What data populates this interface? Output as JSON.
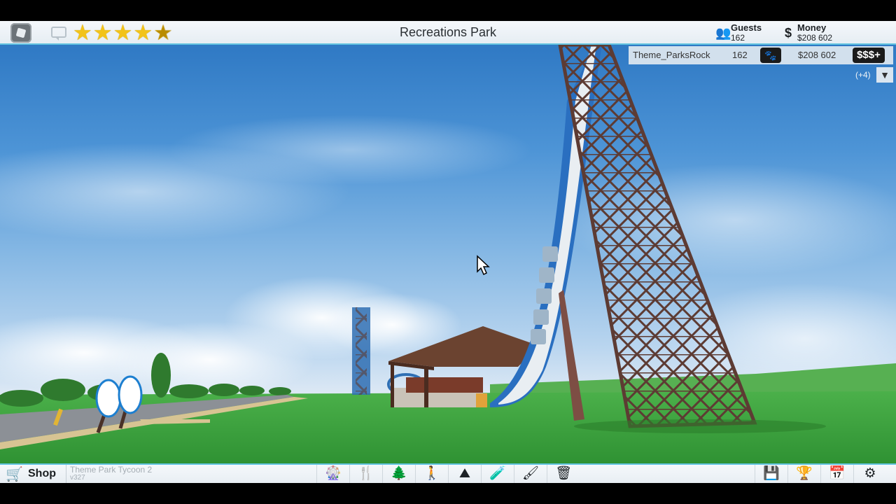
{
  "topbar": {
    "park_name": "Recreations Park",
    "rating_stars": 4.5,
    "guests": {
      "label": "Guests",
      "value": "162",
      "icon": "guests-icon"
    },
    "money": {
      "label": "Money",
      "value": "$208 602",
      "icon": "dollar-icon"
    }
  },
  "player_list": {
    "player_name": "Theme_ParksRock",
    "guests": "162",
    "money": "$208 602",
    "add_money_label": "$$$+",
    "more_players": "(+4)",
    "expand_glyph": "▼"
  },
  "bottombar": {
    "shop_label": "Shop",
    "game_name": "Theme Park Tycoon 2",
    "game_version": "v327",
    "build_tools": [
      {
        "name": "rides-tool",
        "glyph": "🎡"
      },
      {
        "name": "food-stalls-tool",
        "glyph": "🍴"
      },
      {
        "name": "scenery-tool",
        "glyph": "🌲"
      },
      {
        "name": "paths-tool",
        "glyph": "🚶"
      },
      {
        "name": "terrain-tool",
        "glyph": "⛰"
      },
      {
        "name": "eyedropper-tool",
        "glyph": "🧪"
      },
      {
        "name": "paint-tool",
        "glyph": "🖌"
      },
      {
        "name": "delete-tool",
        "glyph": "🗑"
      }
    ],
    "utility_tools": [
      {
        "name": "save-tool",
        "glyph": "💾"
      },
      {
        "name": "trophy-tool",
        "glyph": "🏆"
      },
      {
        "name": "calendar-tool",
        "glyph": "📅"
      },
      {
        "name": "settings-tool",
        "glyph": "⚙"
      }
    ]
  },
  "colors": {
    "accent": "#61c3e0",
    "star": "#f2c318",
    "grass": "#3aa33a",
    "tower": "#5d3b33",
    "track_blue": "#2a6fc0"
  }
}
